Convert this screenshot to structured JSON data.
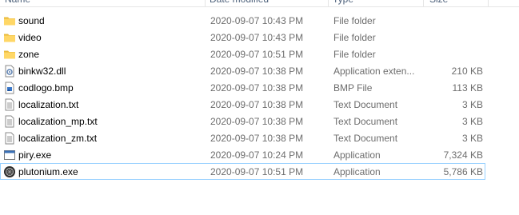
{
  "columns": {
    "name": "Name",
    "date": "Date modified",
    "type": "Type",
    "size": "Size"
  },
  "files": [
    {
      "name": "sound",
      "date": "2020-09-07 10:43 PM",
      "type": "File folder",
      "size": "",
      "icon": "folder-icon"
    },
    {
      "name": "video",
      "date": "2020-09-07 10:43 PM",
      "type": "File folder",
      "size": "",
      "icon": "folder-icon"
    },
    {
      "name": "zone",
      "date": "2020-09-07 10:51 PM",
      "type": "File folder",
      "size": "",
      "icon": "folder-icon"
    },
    {
      "name": "binkw32.dll",
      "date": "2020-09-07 10:38 PM",
      "type": "Application exten...",
      "size": "210 KB",
      "icon": "dll-icon"
    },
    {
      "name": "codlogo.bmp",
      "date": "2020-09-07 10:38 PM",
      "type": "BMP File",
      "size": "113 KB",
      "icon": "image-icon"
    },
    {
      "name": "localization.txt",
      "date": "2020-09-07 10:38 PM",
      "type": "Text Document",
      "size": "3 KB",
      "icon": "text-file-icon"
    },
    {
      "name": "localization_mp.txt",
      "date": "2020-09-07 10:38 PM",
      "type": "Text Document",
      "size": "3 KB",
      "icon": "text-file-icon"
    },
    {
      "name": "localization_zm.txt",
      "date": "2020-09-07 10:38 PM",
      "type": "Text Document",
      "size": "3 KB",
      "icon": "text-file-icon"
    },
    {
      "name": "piry.exe",
      "date": "2020-09-07 10:24 PM",
      "type": "Application",
      "size": "7,324 KB",
      "icon": "exe-icon"
    },
    {
      "name": "plutonium.exe",
      "date": "2020-09-07 10:51 PM",
      "type": "Application",
      "size": "5,786 KB",
      "icon": "plutonium-icon",
      "focused": true
    }
  ],
  "colors": {
    "folder": "#ffd766",
    "folder_dark": "#e8b93a",
    "focus_border": "#99d1ff",
    "exe_blue": "#3a6fb5"
  }
}
